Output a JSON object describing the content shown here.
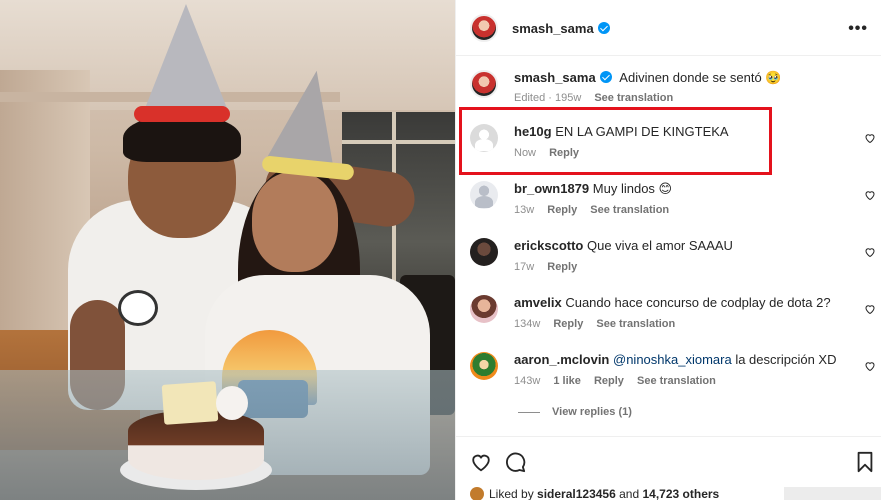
{
  "post": {
    "author": "smash_sama",
    "caption": "Adivinen donde se sentó 🥹",
    "caption_meta": {
      "edited": "Edited · 195w",
      "see_translation": "See translation"
    },
    "more_label": "•••"
  },
  "comments": [
    {
      "user": "he10g",
      "text": "EN LA GAMPI DE KINGTEKA",
      "time": "Now",
      "likes": "",
      "reply": "Reply",
      "translate": ""
    },
    {
      "user": "br_own1879",
      "text": "Muy lindos 😊",
      "time": "13w",
      "likes": "",
      "reply": "Reply",
      "translate": "See translation"
    },
    {
      "user": "erickscotto",
      "text": "Que viva el amor SAAAU",
      "time": "17w",
      "likes": "",
      "reply": "Reply",
      "translate": ""
    },
    {
      "user": "amvelix",
      "text": "Cuando hace concurso de codplay de dota 2?",
      "time": "134w",
      "likes": "",
      "reply": "Reply",
      "translate": "See translation"
    },
    {
      "user": "aaron_.mclovin",
      "mention": "@ninoshka_xiomara",
      "text": " la descripción XD",
      "time": "143w",
      "likes": "1 like",
      "reply": "Reply",
      "translate": "See translation"
    }
  ],
  "view_replies": "View replies (1)",
  "footer": {
    "liked_prefix": "Liked by",
    "liked_user": "sideral123456",
    "liked_and": "and",
    "liked_count": "14,723 others"
  },
  "colors": {
    "verified": "#0095f6",
    "highlight": "#e4121c",
    "link": "#00376b"
  },
  "icons": [
    "heart-icon",
    "comment-icon",
    "bookmark-icon",
    "verified-badge-icon",
    "more-options-icon"
  ]
}
